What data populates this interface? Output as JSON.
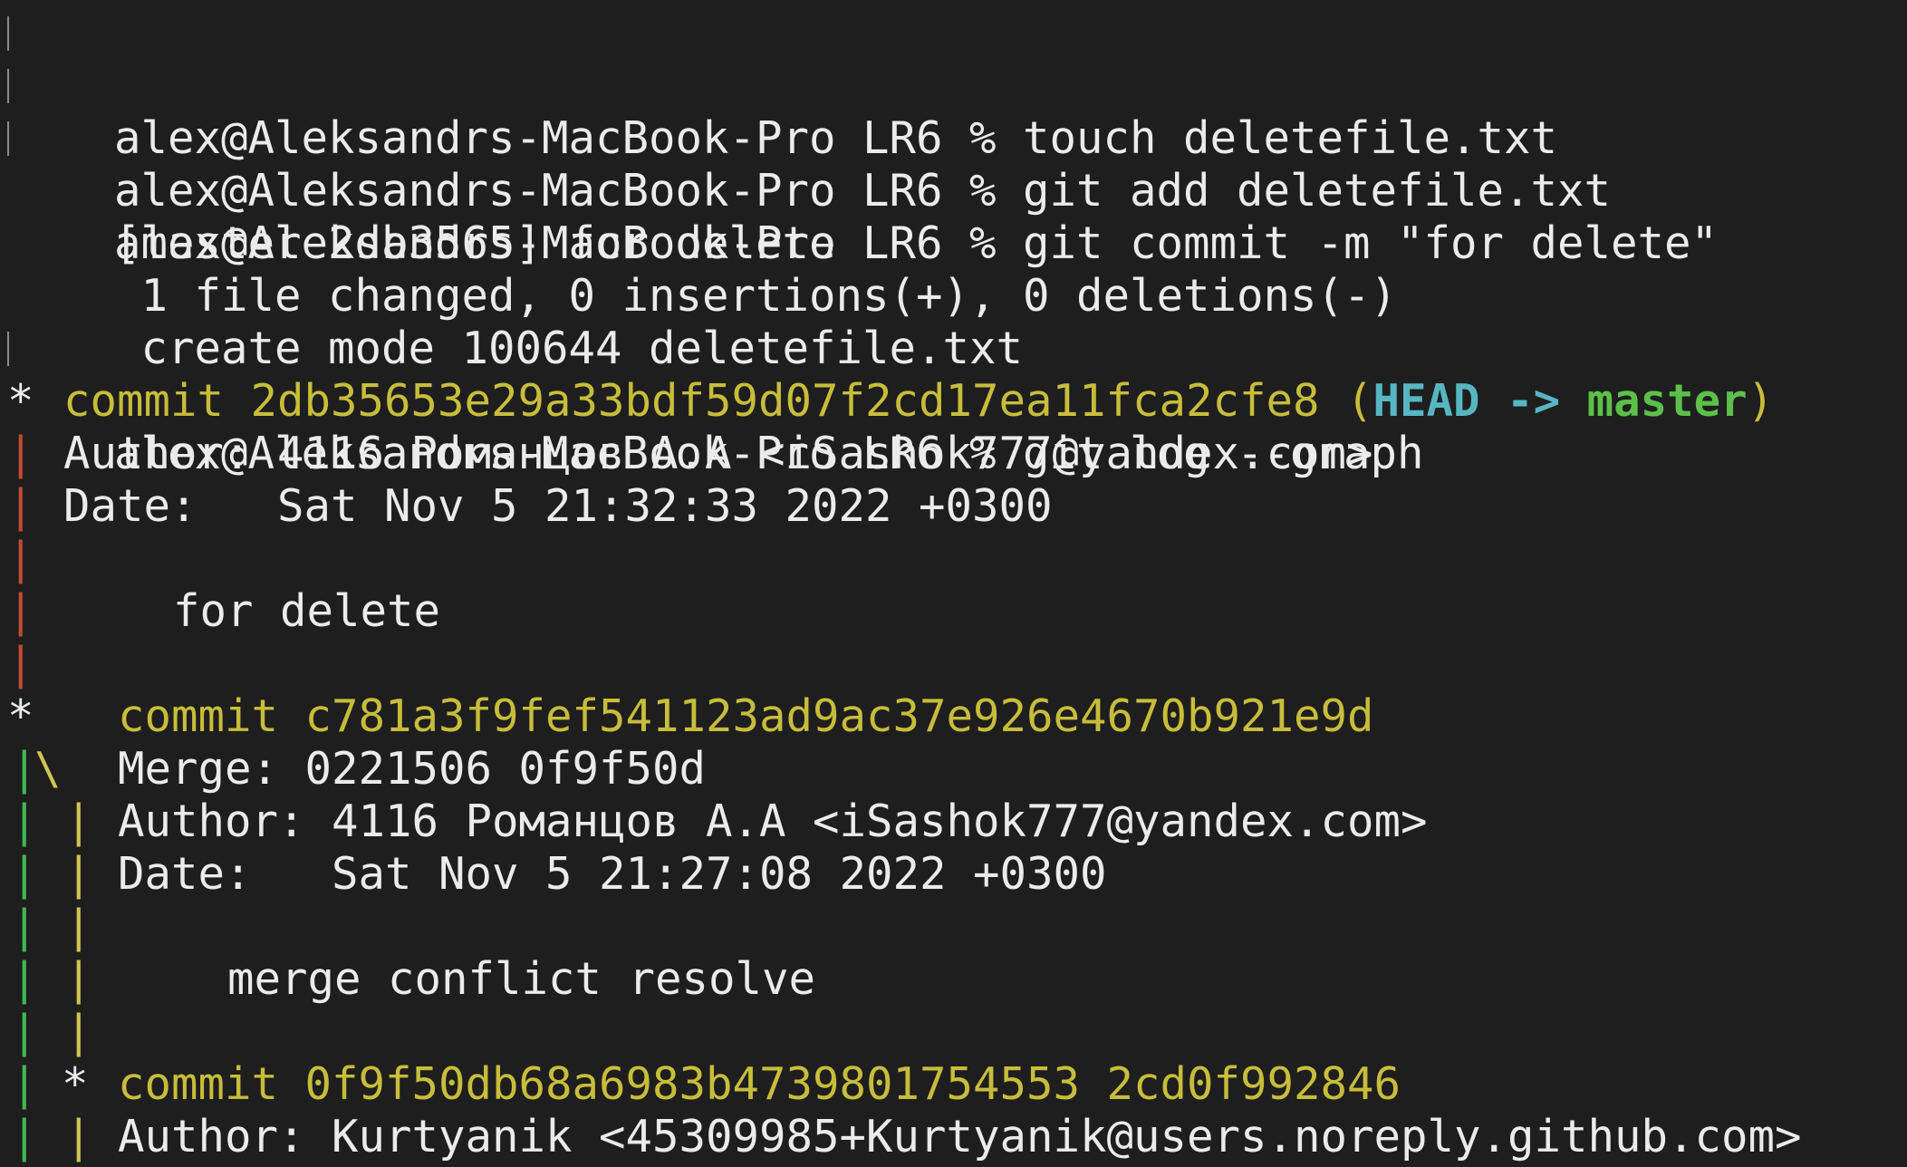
{
  "terminal": {
    "prompt": "alex@Aleksandrs-MacBook-Pro LR6 % ",
    "commands": [
      "touch deletefile.txt",
      "git add deletefile.txt",
      "git commit -m \"for delete\"",
      "git log --graph"
    ],
    "commit_output": [
      "[master 2db3565] for delete",
      " 1 file changed, 0 insertions(+), 0 deletions(-)",
      " create mode 100644 deletefile.txt"
    ],
    "graph_glyphs": {
      "star": "*",
      "pipe": "|",
      "merge_branch": "\\"
    },
    "log": {
      "commit1": {
        "commit_label": "commit 2db35653e29a33bdf59d07f2cd17ea11fca2cfe8",
        "open_paren": " (",
        "head": "HEAD",
        "arrow": " -> ",
        "branch": "master",
        "close_paren": ")",
        "author": "Author: 4116 Романцов А.А <iSashok777@yandex.com>",
        "date": "Date:   Sat Nov 5 21:32:33 2022 +0300",
        "message": "for delete"
      },
      "commit2": {
        "commit_label": "commit c781a3f9fef541123ad9ac37e926e4670b921e9d",
        "merge": "Merge: 0221506 0f9f50d",
        "author": "Author: 4116 Романцов А.А <iSashok777@yandex.com>",
        "date": "Date:   Sat Nov 5 21:27:08 2022 +0300",
        "message": "merge conflict resolve"
      },
      "commit3": {
        "commit_label": "commit 0f9f50db68a6983b4739801754553 2cd0f992846",
        "author": "Author: Kurtyanik <45309985+Kurtyanik@users.noreply.github.com>"
      }
    }
  },
  "colors": {
    "background": "#1e1e1e",
    "text": "#ebebeb",
    "commit_hash": "#c8bd3a",
    "head": "#56b6c2",
    "branch": "#5cc04a",
    "graph_red": "#c24a2e",
    "graph_green": "#3fb950",
    "graph_yellow": "#d2c451"
  }
}
